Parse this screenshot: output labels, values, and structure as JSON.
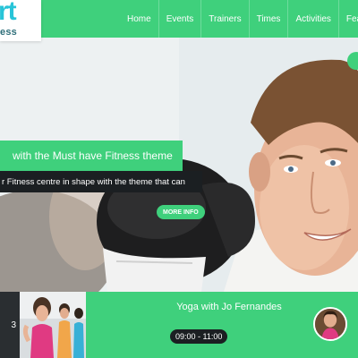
{
  "header": {
    "logo_main": "rt",
    "logo_sub": "ess",
    "nav": [
      {
        "label": "Home"
      },
      {
        "label": "Events"
      },
      {
        "label": "Trainers"
      },
      {
        "label": "Times"
      },
      {
        "label": "Activities"
      },
      {
        "label": "Features"
      }
    ]
  },
  "hero": {
    "headline": "with the Must have Fitness theme",
    "subline": "r Fitness centre in shape with the theme that can",
    "cta_label": "MORE INFO"
  },
  "schedule": {
    "left_number": "3",
    "class_title": "Yoga with Jo Fernandes",
    "class_time": "09:00 - 11:00"
  },
  "colors": {
    "brand_green": "#3fd07c",
    "logo_cyan": "#28c4d8",
    "dark": "#1b1f22"
  }
}
